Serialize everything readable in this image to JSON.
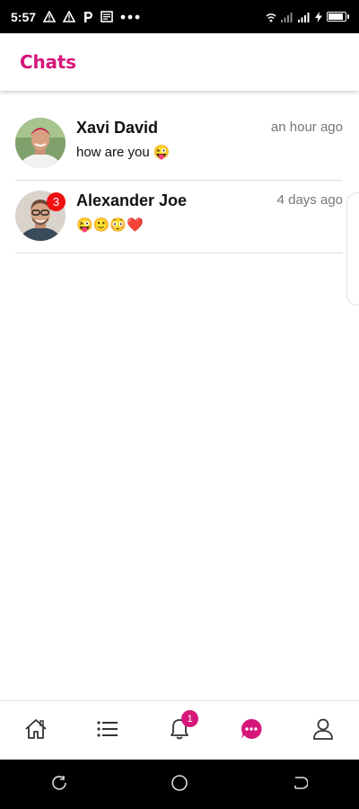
{
  "status_bar": {
    "time": "5:57",
    "icons_left": [
      "warning-icon",
      "warning-icon",
      "parking-icon",
      "news-icon",
      "more-dots-icon"
    ],
    "icons_right": [
      "wifi-icon",
      "signal-icon",
      "signal-icon",
      "battery-icon"
    ]
  },
  "header": {
    "title": "Chats"
  },
  "chats": [
    {
      "name": "Xavi David",
      "time": "an hour ago",
      "message": "how are you 😜",
      "unread": ""
    },
    {
      "name": "Alexander Joe",
      "time": "4 days ago",
      "message": "😜🙂😳❤️",
      "unread": "3"
    }
  ],
  "bottom_nav": {
    "items": [
      "home-icon",
      "list-icon",
      "bell-icon",
      "chat-icon",
      "profile-icon"
    ],
    "notification_count": "1",
    "active": "chat-icon"
  },
  "colors": {
    "accent": "#d6167a",
    "badge_red": "#f01010",
    "text_muted": "#777777"
  }
}
